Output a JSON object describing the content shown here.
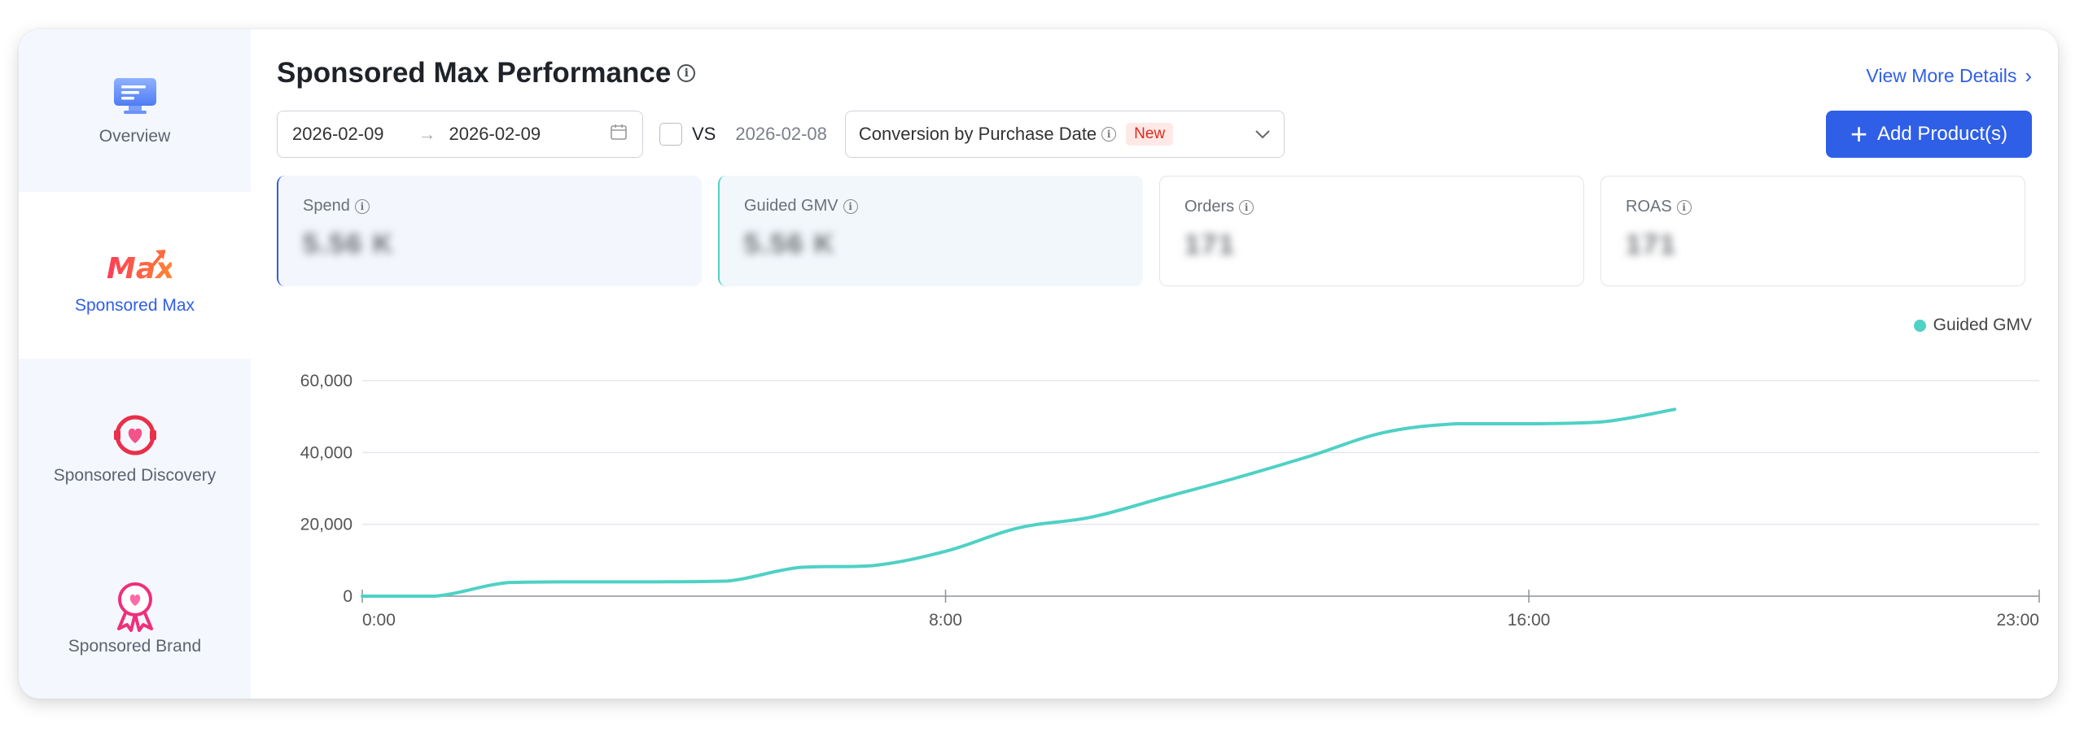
{
  "sidebar": {
    "items": [
      {
        "label": "Overview",
        "icon": "overview-icon",
        "active": false
      },
      {
        "label": "Sponsored Max",
        "icon": "max-logo-icon",
        "active": true
      },
      {
        "label": "Sponsored Discovery",
        "icon": "discovery-heart-icon",
        "active": false
      },
      {
        "label": "Sponsored Brand",
        "icon": "brand-ribbon-icon",
        "active": false
      }
    ]
  },
  "header": {
    "title": "Sponsored Max Performance",
    "view_more": "View More Details",
    "add_button": "Add Product(s)"
  },
  "filters": {
    "date_start": "2026-02-09",
    "date_end": "2026-02-09",
    "vs_label": "VS",
    "vs_checked": false,
    "vs_date": "2026-02-08",
    "conversion_select": "Conversion by Purchase Date",
    "new_badge": "New"
  },
  "metrics": [
    {
      "label": "Spend",
      "value": "5.56 K"
    },
    {
      "label": "Guided GMV",
      "value": "5.56 K"
    },
    {
      "label": "Orders",
      "value": "171"
    },
    {
      "label": "ROAS",
      "value": "171"
    }
  ],
  "colors": {
    "accent": "#2f5fe7",
    "series": "#4fd1c5",
    "new_badge_text": "#e0291b"
  },
  "chart_data": {
    "type": "line",
    "series": [
      {
        "name": "Guided GMV",
        "x": [
          0,
          1,
          2,
          3,
          4,
          5,
          6,
          7,
          8,
          9,
          10,
          11,
          12,
          13,
          14,
          15,
          16,
          17,
          18
        ],
        "values": [
          0,
          0,
          3800,
          4000,
          4000,
          4200,
          8000,
          8500,
          12500,
          19000,
          22000,
          27500,
          33000,
          39000,
          45500,
          48000,
          48000,
          48500,
          52000
        ]
      }
    ],
    "x_ticks": [
      "0:00",
      "8:00",
      "16:00",
      "23:00"
    ],
    "x_tick_values": [
      0,
      8,
      16,
      23
    ],
    "xlim": [
      0,
      23
    ],
    "y_ticks": [
      "0",
      "20,000",
      "40,000",
      "60,000"
    ],
    "y_tick_values": [
      0,
      20000,
      40000,
      60000
    ],
    "ylim": [
      0,
      60000
    ],
    "grid": true,
    "legend": "top-right"
  }
}
